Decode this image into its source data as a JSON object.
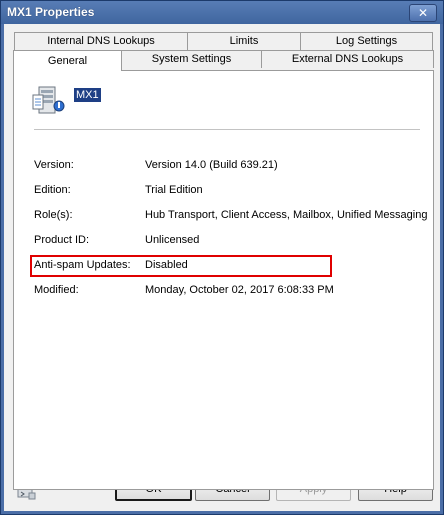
{
  "window": {
    "title": "MX1 Properties",
    "close_glyph": "✕"
  },
  "tabs_row1": [
    {
      "label": "Internal DNS Lookups"
    },
    {
      "label": "Limits"
    },
    {
      "label": "Log Settings"
    }
  ],
  "tabs_row2": [
    {
      "label": "General",
      "active": true
    },
    {
      "label": "System Settings"
    },
    {
      "label": "External DNS Lookups"
    }
  ],
  "general": {
    "server_icon": "server-icon",
    "server_name": "MX1",
    "fields": [
      {
        "label": "Version:",
        "value": "Version 14.0 (Build 639.21)"
      },
      {
        "label": "Edition:",
        "value": "Trial Edition"
      },
      {
        "label": "Role(s):",
        "value": "Hub Transport, Client Access, Mailbox, Unified Messaging"
      },
      {
        "label": "Product ID:",
        "value": "Unlicensed"
      },
      {
        "label": "Anti-spam Updates:",
        "value": "Disabled"
      },
      {
        "label": "Modified:",
        "value": "Monday, October 02, 2017 6:08:33 PM"
      }
    ],
    "highlight_color": "#e00000"
  },
  "buttons": {
    "ok": "OK",
    "cancel": "Cancel",
    "apply": "Apply",
    "help": "Help"
  },
  "colors": {
    "title_bar": "#4b6ea7",
    "selection": "#1e3f85"
  }
}
